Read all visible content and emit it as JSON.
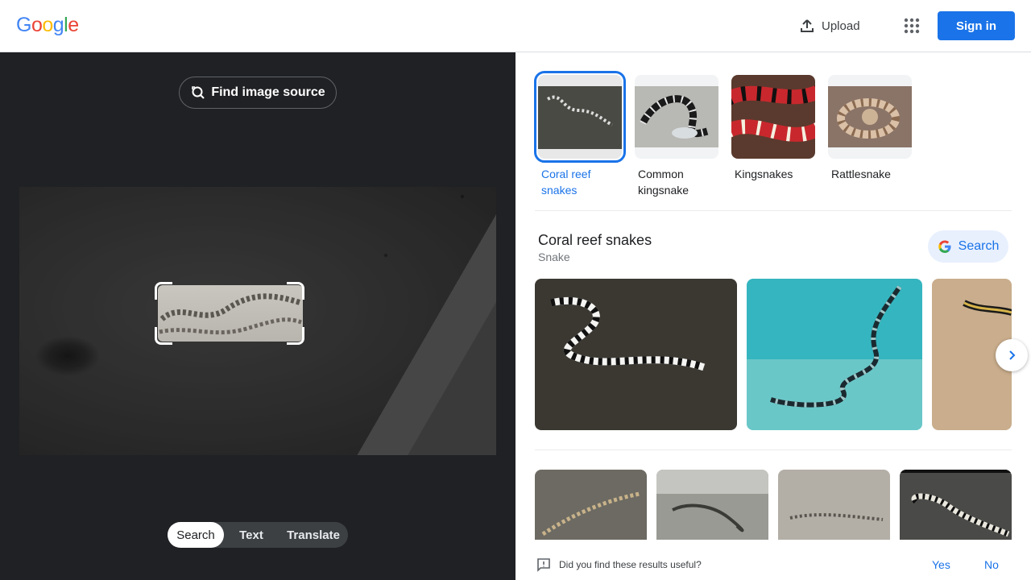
{
  "header": {
    "logo_letters": [
      "G",
      "o",
      "o",
      "g",
      "l",
      "e"
    ],
    "upload_label": "Upload",
    "apps_icon": "apps-grid-icon",
    "signin_label": "Sign in"
  },
  "left_panel": {
    "find_source_label": "Find image source",
    "modes": [
      {
        "label": "Search",
        "active": true
      },
      {
        "label": "Text",
        "active": false
      },
      {
        "label": "Translate",
        "active": false
      }
    ]
  },
  "categories": [
    {
      "label": "Coral reef snakes",
      "selected": true
    },
    {
      "label": "Common kingsnake",
      "selected": false
    },
    {
      "label": "Kingsnakes",
      "selected": false
    },
    {
      "label": "Rattlesnake",
      "selected": false
    }
  ],
  "entity": {
    "title": "Coral reef snakes",
    "subtitle": "Snake",
    "search_label": "Search"
  },
  "feedback": {
    "question": "Did you find these results useful?",
    "yes": "Yes",
    "no": "No"
  },
  "colors": {
    "accent": "#1a73e8",
    "dark_panel": "#202124",
    "google_blue": "#4285f4",
    "google_red": "#ea4335",
    "google_yellow": "#fbbc05",
    "google_green": "#34a853"
  }
}
